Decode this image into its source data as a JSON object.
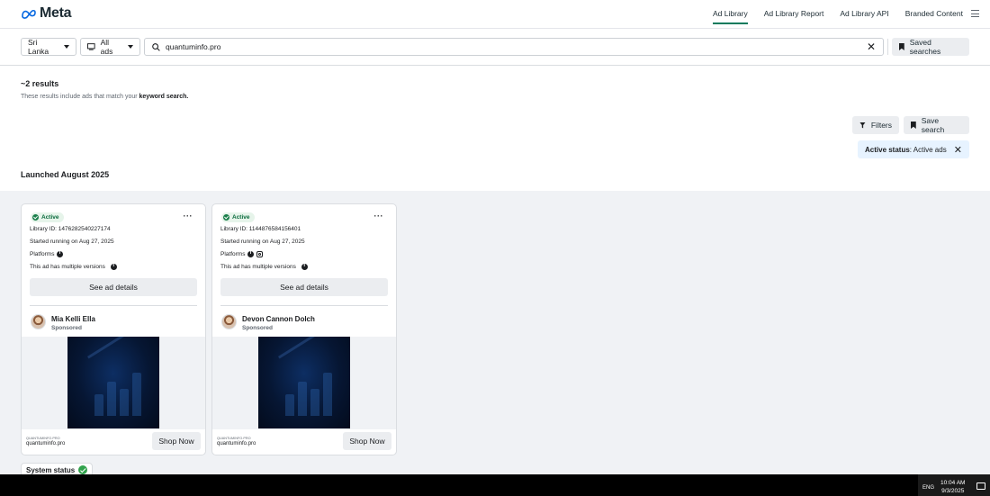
{
  "header": {
    "logo": "Meta",
    "nav": [
      "Ad Library",
      "Ad Library Report",
      "Ad Library API",
      "Branded Content"
    ]
  },
  "search": {
    "country": "Sri Lanka",
    "ad_type": "All ads",
    "query": "quantuminfo.pro",
    "saved_searches": "Saved searches"
  },
  "results": {
    "count": "~2 results",
    "note_prefix": "These results include ads that match your ",
    "note_bold": "keyword search.",
    "filters": "Filters",
    "save_search": "Save search",
    "status_label": "Active status",
    "status_value": ": Active ads",
    "section_heading": "Launched August 2025"
  },
  "cards": [
    {
      "status": "Active",
      "library_id": "Library ID: 1476282540227174",
      "started": "Started running on Aug 27, 2025",
      "platforms_label": "Platforms",
      "versions": "This ad has multiple versions",
      "see_details": "See ad details",
      "advertiser": "Mia Kelli Ella",
      "sponsored": "Sponsored",
      "domain_caps": "QUANTUMINFO.PRO",
      "domain": "quantuminfo.pro",
      "cta": "Shop Now"
    },
    {
      "status": "Active",
      "library_id": "Library ID: 1144876584156401",
      "started": "Started running on Aug 27, 2025",
      "platforms_label": "Platforms",
      "versions": "This ad has multiple versions",
      "see_details": "See ad details",
      "advertiser": "Devon Cannon Dolch",
      "sponsored": "Sponsored",
      "domain_caps": "QUANTUMINFO.PRO",
      "domain": "quantuminfo.pro",
      "cta": "Shop Now"
    }
  ],
  "system_status": "System status",
  "taskbar": {
    "lang": "ENG",
    "time": "10:04 AM",
    "date": "9/3/2025"
  },
  "colors": {
    "accent": "#0a7b5d",
    "chip_bg": "#e7f3ff",
    "active_green": "#1a7f4b"
  }
}
